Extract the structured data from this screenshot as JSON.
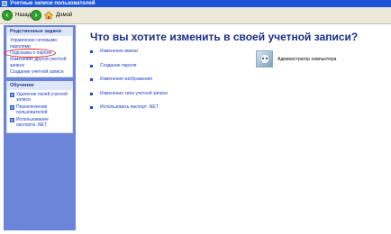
{
  "window": {
    "title": "Учетные записи пользователей"
  },
  "toolbar": {
    "back_label": "Назад",
    "home_label": "Домой"
  },
  "related_tasks": {
    "title": "Родственные задачи",
    "items": [
      {
        "label": "Управление сетевыми"
      },
      {
        "label": "паролями"
      },
      {
        "label": "Подсказка о пароле"
      },
      {
        "label": "Изменение другой учетной"
      },
      {
        "label": "записи"
      },
      {
        "label": "Создание учетной записи"
      }
    ]
  },
  "learn_about": {
    "title": "Обучение",
    "items": [
      {
        "label": "Удаление своей учетной\nзаписи"
      },
      {
        "label": "Переключение\nпользователей"
      },
      {
        "label": "Использование\nпаспорта .NET"
      }
    ]
  },
  "main": {
    "heading": "Что вы хотите изменить в своей учетной записи?",
    "options": [
      {
        "label": "Изменение имени"
      },
      {
        "label": "Создание пароля"
      },
      {
        "label": "Изменение изображения"
      },
      {
        "label": "Изменение типа учетной записи"
      },
      {
        "label": "Использовать паспорт .NET"
      }
    ],
    "account_name": "Администратор компьютера"
  },
  "colors": {
    "title_bar": "#1d54d8",
    "sidebar": "#6b86d8",
    "link": "#1f3fbf",
    "heading": "#1b2f8a",
    "highlight_circle": "#e21c1c"
  }
}
